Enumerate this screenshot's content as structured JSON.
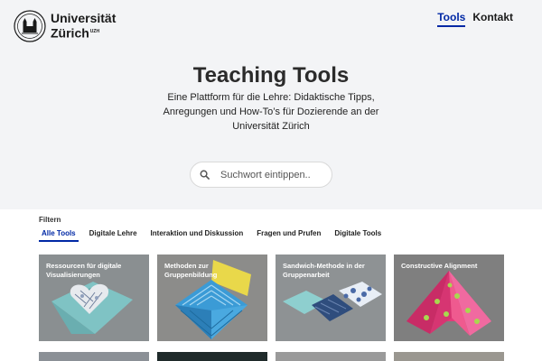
{
  "header": {
    "logo_line1": "Universität",
    "logo_line2": "Zürich",
    "logo_sup": "UZH",
    "nav": [
      {
        "label": "Tools",
        "active": true
      },
      {
        "label": "Kontakt",
        "active": false
      }
    ]
  },
  "hero": {
    "title": "Teaching Tools",
    "subtitle": "Eine Plattform für die Lehre: Didaktische Tipps, Anregungen und How-To’s für Dozierende an der Universität Zürich"
  },
  "search": {
    "placeholder": "Suchwort eintippen.."
  },
  "filters": {
    "label": "Filtern",
    "items": [
      "Alle Tools",
      "Digitale Lehre",
      "Interaktion und Diskussion",
      "Fragen und Prufen",
      "Digitale Tools"
    ],
    "active": "Alle Tools"
  },
  "cards": [
    {
      "title": "Ressourcen für digitale Visualisierungen"
    },
    {
      "title": "Methoden zur Gruppenbildung"
    },
    {
      "title": "Sandwich-Methode in der Gruppenarbeit"
    },
    {
      "title": "Constructive Alignment"
    }
  ],
  "colors": {
    "accent": "#0028a5",
    "hero_bg": "#f3f4f6",
    "card_bg": "#9a9a9a"
  }
}
